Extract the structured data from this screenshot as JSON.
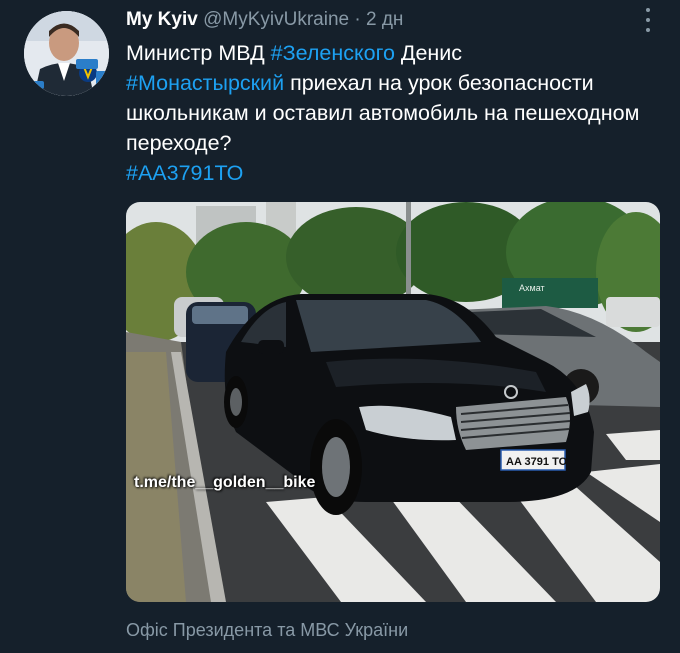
{
  "tweet": {
    "author_name": "My Kyiv",
    "author_handle": "@MyKyivUkraine",
    "separator": "·",
    "time": "2 дн",
    "text": {
      "part1": "Министр МВД ",
      "hashtag1": "#Зеленского",
      "part2": " Денис ",
      "hashtag2": "#Монастырский",
      "part3": "  приехал на урок безопасности школьникам и оставил автомобиль на пешеходном переходе?",
      "hashtag3": "#АА3791ТО"
    },
    "media": {
      "watermark": "t.me/the__golden__bike",
      "license_plate": "AA 3791 TO",
      "sign_text": "Ахмат"
    },
    "caption": "Офіс Президента та МВС України"
  },
  "colors": {
    "background": "#15202b",
    "link": "#1da1f2",
    "secondary_text": "#8899a6"
  },
  "icons": {
    "more": "more-vertical-icon"
  }
}
